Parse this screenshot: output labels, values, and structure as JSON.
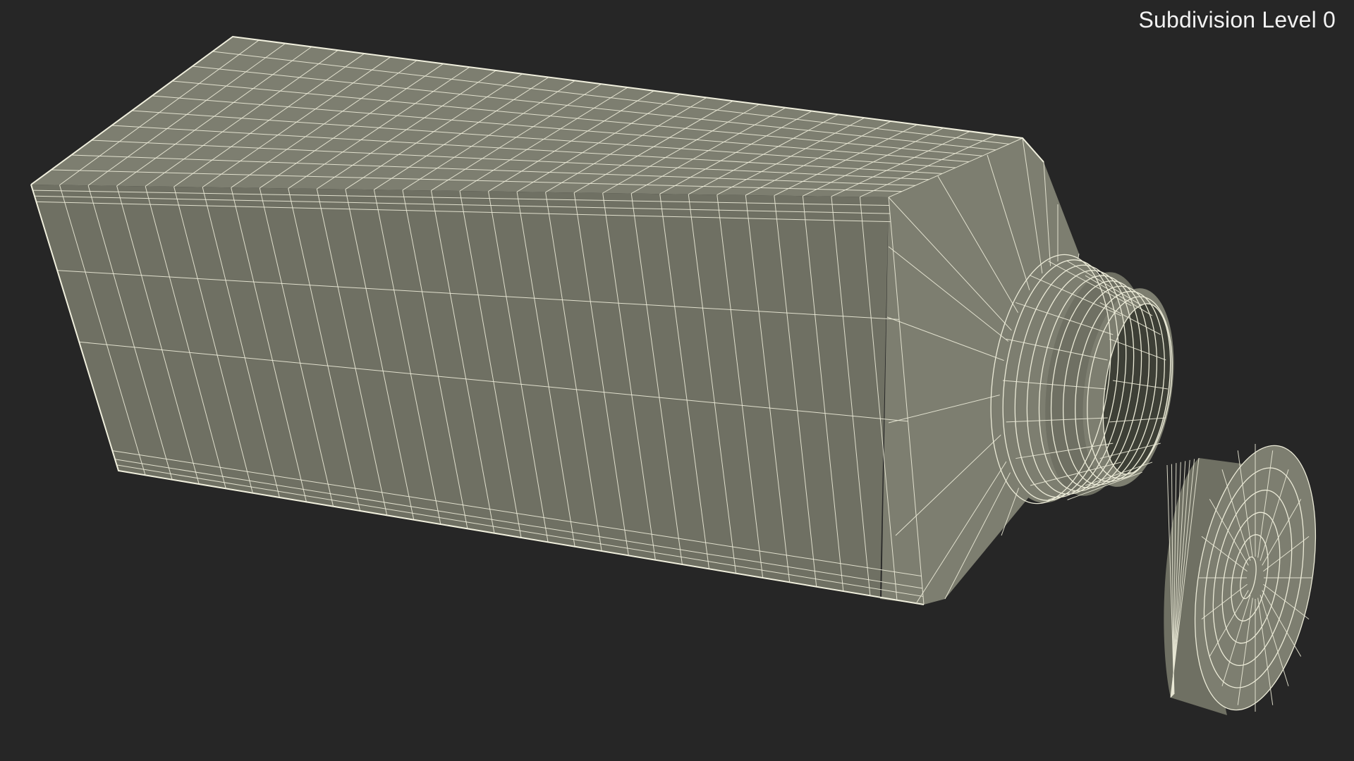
{
  "viewport": {
    "overlay_label": "Subdivision Level 0",
    "background_color": "#262626",
    "mesh_face_color": "#7d7e70",
    "wire_color": "#ecebd8"
  },
  "scene": {
    "objects": [
      "bottle-body",
      "bottle-neck",
      "bottle-cap"
    ]
  }
}
